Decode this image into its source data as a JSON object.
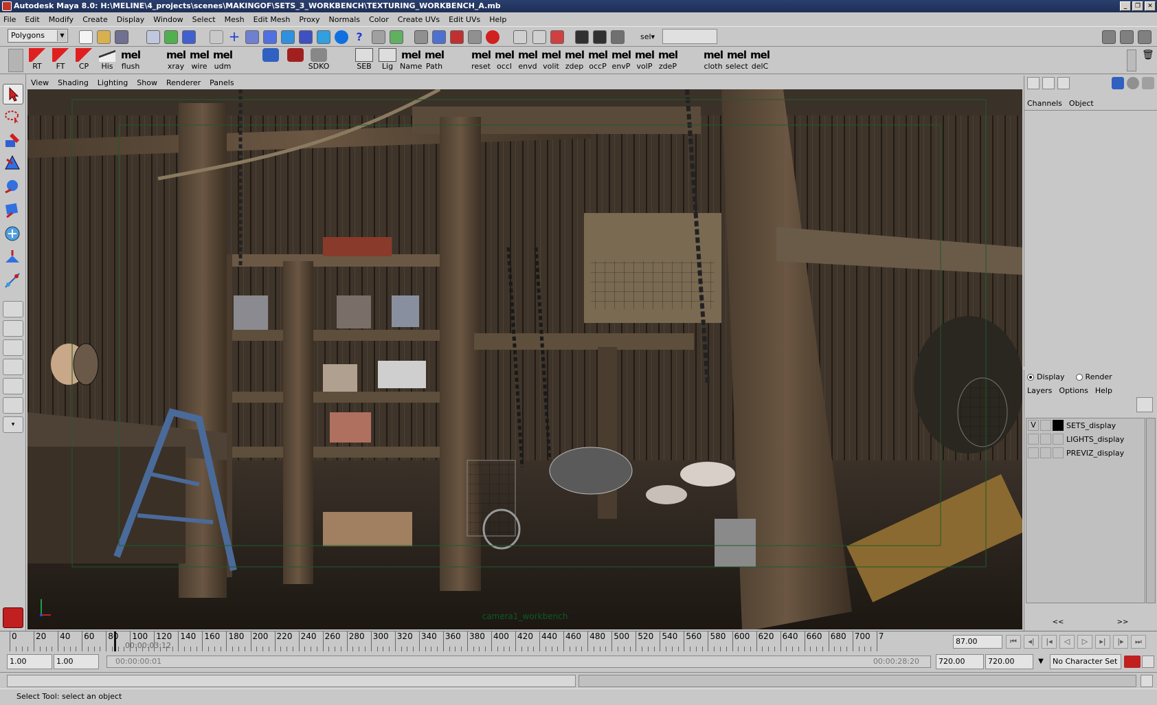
{
  "window": {
    "title": "Autodesk Maya 8.0: H:\\MELINE\\4_projects\\scenes\\MAKINGOF\\SETS_3_WORKBENCH\\TEXTURING_WORKBENCH_A.mb"
  },
  "menus": [
    "File",
    "Edit",
    "Modify",
    "Create",
    "Display",
    "Window",
    "Select",
    "Mesh",
    "Edit Mesh",
    "Proxy",
    "Normals",
    "Color",
    "Create UVs",
    "Edit UVs",
    "Help"
  ],
  "statusline": {
    "mode": "Polygons",
    "sel_label": "sel▾",
    "sel_value": ""
  },
  "shelf": {
    "buttons": [
      {
        "label": "RT",
        "kind": "arrow"
      },
      {
        "label": "FT",
        "kind": "arrow"
      },
      {
        "label": "CP",
        "kind": "arrow"
      },
      {
        "label": "His",
        "kind": "broom"
      },
      {
        "label": "flush",
        "kind": "mel"
      },
      {
        "label": "xray",
        "kind": "mel"
      },
      {
        "label": "wire",
        "kind": "mel"
      },
      {
        "label": "udm",
        "kind": "mel"
      },
      {
        "label": "",
        "kind": "icon"
      },
      {
        "label": "",
        "kind": "icon"
      },
      {
        "label": "SDKO",
        "kind": "icon"
      },
      {
        "label": "SEB",
        "kind": "box"
      },
      {
        "label": "Lig",
        "kind": "box"
      },
      {
        "label": "Name",
        "kind": "mel"
      },
      {
        "label": "Path",
        "kind": "mel"
      },
      {
        "label": "reset",
        "kind": "mel"
      },
      {
        "label": "occl",
        "kind": "mel"
      },
      {
        "label": "envd",
        "kind": "mel"
      },
      {
        "label": "volit",
        "kind": "mel"
      },
      {
        "label": "zdep",
        "kind": "mel"
      },
      {
        "label": "occP",
        "kind": "mel"
      },
      {
        "label": "envP",
        "kind": "mel"
      },
      {
        "label": "volP",
        "kind": "mel"
      },
      {
        "label": "zdeP",
        "kind": "mel"
      },
      {
        "label": "cloth",
        "kind": "mel"
      },
      {
        "label": "select",
        "kind": "mel"
      },
      {
        "label": "delC",
        "kind": "mel"
      }
    ],
    "mel_text": "mel"
  },
  "panel_menu": [
    "View",
    "Shading",
    "Lighting",
    "Show",
    "Renderer",
    "Panels"
  ],
  "viewport": {
    "camera_label": "camera1_workbench"
  },
  "channel_box": {
    "tabs": [
      "Channels",
      "Object"
    ]
  },
  "layer_editor": {
    "radio_display": "Display",
    "radio_render": "Render",
    "menus": [
      "Layers",
      "Options",
      "Help"
    ],
    "layers": [
      {
        "visible": "V",
        "name": "SETS_display"
      },
      {
        "visible": "",
        "name": "LIGHTS_display"
      },
      {
        "visible": "",
        "name": "PREVIZ_display"
      }
    ],
    "nav_left": "<<",
    "nav_right": ">>"
  },
  "timeline": {
    "ticks": [
      "0",
      "20",
      "40",
      "60",
      "80",
      "100",
      "120",
      "140",
      "160",
      "180",
      "200",
      "220",
      "240",
      "260",
      "280",
      "300",
      "320",
      "340",
      "360",
      "380",
      "400",
      "420",
      "440",
      "460",
      "480",
      "500",
      "520",
      "540",
      "560",
      "580",
      "600",
      "620",
      "640",
      "660",
      "680",
      "700",
      "7"
    ],
    "timecode": "00:00:03:12",
    "current_frame": "87.00"
  },
  "range": {
    "start_time": "1.00",
    "playback_start": "1.00",
    "slider_start_tc": "00:00:00:01",
    "slider_end_tc": "00:00:28:20",
    "playback_end": "720.00",
    "end_time": "720.00",
    "character_set": "No Character Set"
  },
  "help_line": "Select Tool: select an object",
  "colors": {
    "accent_red": "#c02020",
    "viewport_bg": "#2b2520",
    "camera_label": "#0c5a24"
  }
}
